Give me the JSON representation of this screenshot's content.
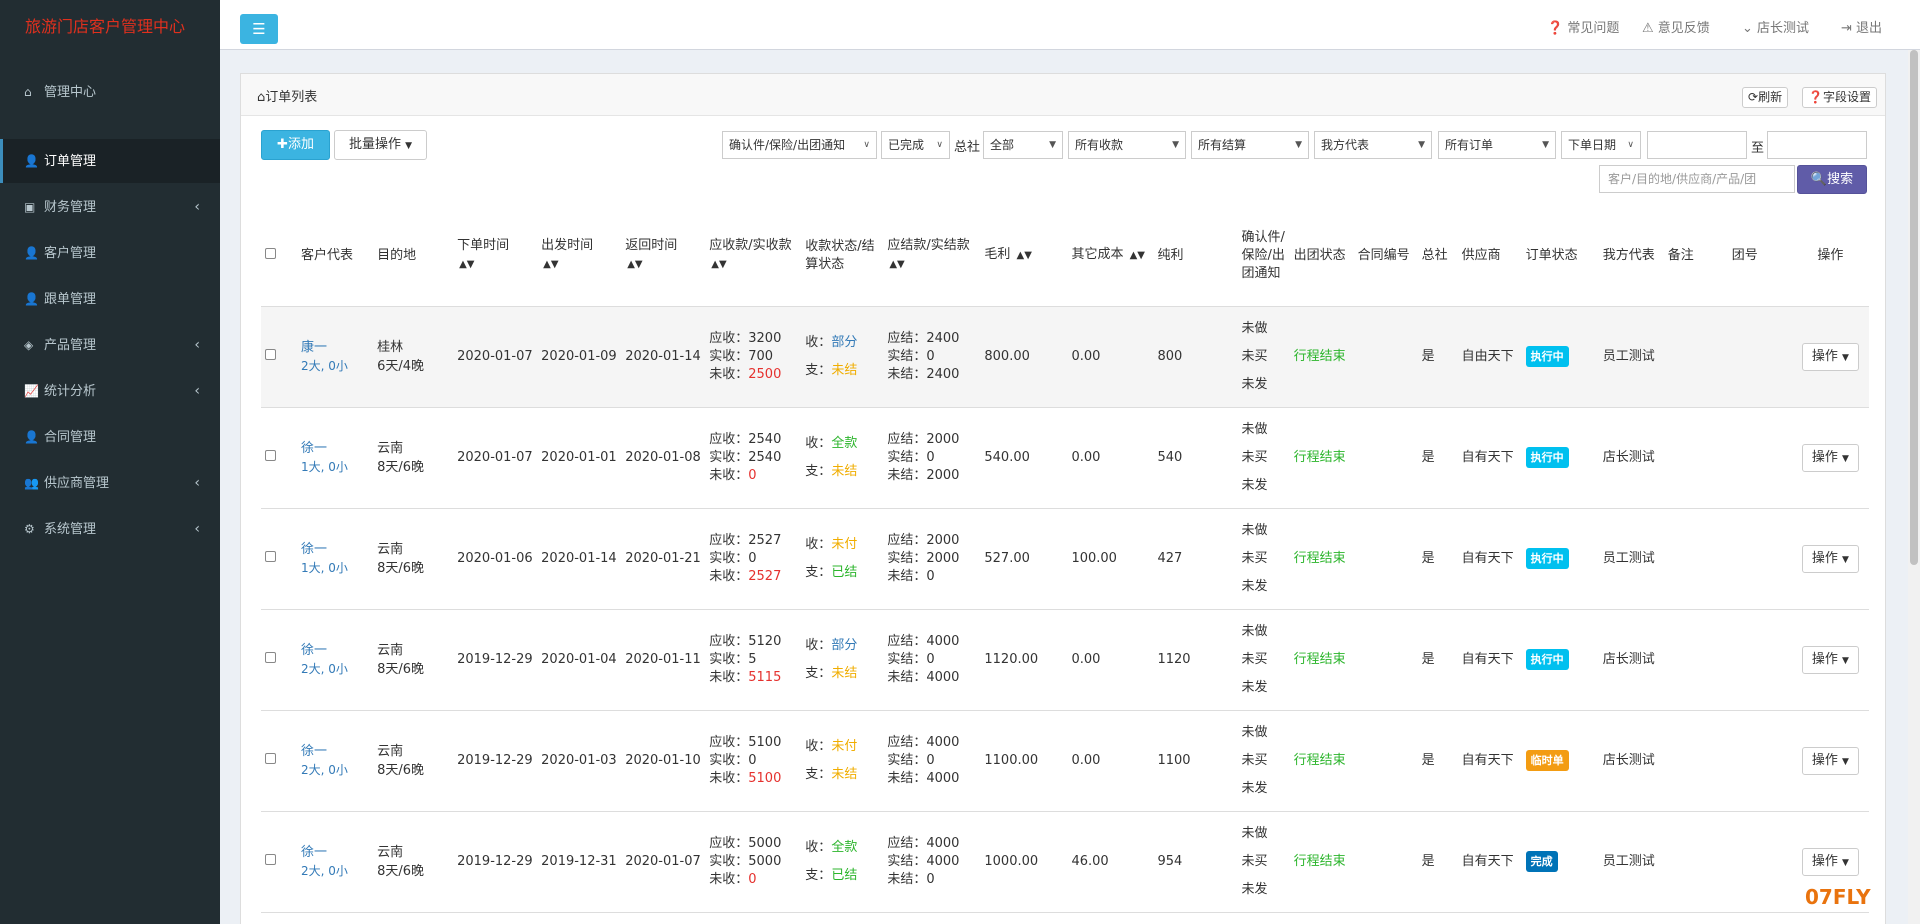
{
  "brand": "旅游门店客户管理中心",
  "nav": [
    {
      "label": "管理中心",
      "icon": "home-icon",
      "active": false,
      "arrow": false
    },
    {
      "label": "订单管理",
      "icon": "user-icon",
      "active": true,
      "arrow": false
    },
    {
      "label": "财务管理",
      "icon": "money-icon",
      "active": false,
      "arrow": true
    },
    {
      "label": "客户管理",
      "icon": "user-icon",
      "active": false,
      "arrow": false
    },
    {
      "label": "跟单管理",
      "icon": "user-icon",
      "active": false,
      "arrow": false
    },
    {
      "label": "产品管理",
      "icon": "cube-icon",
      "active": false,
      "arrow": true
    },
    {
      "label": "统计分析",
      "icon": "chart-icon",
      "active": false,
      "arrow": true
    },
    {
      "label": "合同管理",
      "icon": "user-icon",
      "active": false,
      "arrow": false
    },
    {
      "label": "供应商管理",
      "icon": "users-icon",
      "active": false,
      "arrow": true
    },
    {
      "label": "系统管理",
      "icon": "cogs-icon",
      "active": false,
      "arrow": true
    }
  ],
  "header": {
    "faq": "常见问题",
    "feedback": "意见反馈",
    "user": "店长测试",
    "logout": "退出"
  },
  "panel": {
    "title": "订单列表",
    "refresh": "刷新",
    "field_settings": "字段设置"
  },
  "toolbar": {
    "add": "添加",
    "batch": "批量操作",
    "notify_filter": "确认件/保险/出团通知",
    "status_filter": "已完成",
    "hq_label": "总社",
    "hq_select": "全部",
    "receipt_select": "所有收款",
    "settle_select": "所有结算",
    "rep_select": "我方代表",
    "order_select": "所有订单",
    "date_type": "下单日期",
    "to_label": "至",
    "search_placeholder": "客户/目的地/供应商/产品/团",
    "search_btn": "搜索"
  },
  "columns": {
    "customer": "客户代表",
    "dest": "目的地",
    "order_time": "下单时间",
    "depart_time": "出发时间",
    "return_time": "返回时间",
    "receivable": "应收款/实收款",
    "pay_status": "收款状态/结算状态",
    "payable": "应结款/实结款",
    "gross": "毛利",
    "other_cost": "其它成本",
    "net": "纯利",
    "confirm": "确认件/保险/出团通知",
    "tour_status": "出团状态",
    "contract_no": "合同编号",
    "hq": "总社",
    "supplier": "供应商",
    "order_status": "订单状态",
    "rep": "我方代表",
    "remark": "备注",
    "group_no": "团号",
    "action": "操作"
  },
  "rows": [
    {
      "name": "康一",
      "people": "2大, 0小",
      "dest": "桂林",
      "days": "6天/4晚",
      "order": "2020-01-07",
      "depart": "2020-01-09",
      "ret": "2020-01-14",
      "rcv": "应收：3200",
      "got": "实收：700",
      "unrcv_label": "未收：",
      "unrcv": "2500",
      "in_label": "收：",
      "in_status": "部分",
      "out_label": "支：",
      "out_status": "未结",
      "pay": "应结：2400",
      "paid": "实结：0",
      "unpaid": "未结：2400",
      "gross": "800.00",
      "cost": "0.00",
      "net": "800",
      "c1": "未做",
      "c2": "未买",
      "c3": "未发",
      "tour": "行程结束",
      "hq": "是",
      "supplier": "自由天下",
      "status": "执行中",
      "status_color": "#00c0ef",
      "rep": "员工测试",
      "op": "操作"
    },
    {
      "name": "徐一",
      "people": "1大, 0小",
      "dest": "云南",
      "days": "8天/6晚",
      "order": "2020-01-07",
      "depart": "2020-01-01",
      "ret": "2020-01-08",
      "rcv": "应收：2540",
      "got": "实收：2540",
      "unrcv_label": "未收：",
      "unrcv": "0",
      "in_label": "收：",
      "in_status": "全款",
      "out_label": "支：",
      "out_status": "未结",
      "pay": "应结：2000",
      "paid": "实结：0",
      "unpaid": "未结：2000",
      "gross": "540.00",
      "cost": "0.00",
      "net": "540",
      "c1": "未做",
      "c2": "未买",
      "c3": "未发",
      "tour": "行程结束",
      "hq": "是",
      "supplier": "自有天下",
      "status": "执行中",
      "status_color": "#00c0ef",
      "rep": "店长测试",
      "op": "操作"
    },
    {
      "name": "徐一",
      "people": "1大, 0小",
      "dest": "云南",
      "days": "8天/6晚",
      "order": "2020-01-06",
      "depart": "2020-01-14",
      "ret": "2020-01-21",
      "rcv": "应收：2527",
      "got": "实收：0",
      "unrcv_label": "未收：",
      "unrcv": "2527",
      "in_label": "收：",
      "in_status": "未付",
      "out_label": "支：",
      "out_status": "已结",
      "pay": "应结：2000",
      "paid": "实结：2000",
      "unpaid": "未结：0",
      "gross": "527.00",
      "cost": "100.00",
      "net": "427",
      "c1": "未做",
      "c2": "未买",
      "c3": "未发",
      "tour": "行程结束",
      "hq": "是",
      "supplier": "自有天下",
      "status": "执行中",
      "status_color": "#00c0ef",
      "rep": "员工测试",
      "op": "操作"
    },
    {
      "name": "徐一",
      "people": "2大, 0小",
      "dest": "云南",
      "days": "8天/6晚",
      "order": "2019-12-29",
      "depart": "2020-01-04",
      "ret": "2020-01-11",
      "rcv": "应收：5120",
      "got": "实收：5",
      "unrcv_label": "未收：",
      "unrcv": "5115",
      "in_label": "收：",
      "in_status": "部分",
      "out_label": "支：",
      "out_status": "未结",
      "pay": "应结：4000",
      "paid": "实结：0",
      "unpaid": "未结：4000",
      "gross": "1120.00",
      "cost": "0.00",
      "net": "1120",
      "c1": "未做",
      "c2": "未买",
      "c3": "未发",
      "tour": "行程结束",
      "hq": "是",
      "supplier": "自有天下",
      "status": "执行中",
      "status_color": "#00c0ef",
      "rep": "店长测试",
      "op": "操作"
    },
    {
      "name": "徐一",
      "people": "2大, 0小",
      "dest": "云南",
      "days": "8天/6晚",
      "order": "2019-12-29",
      "depart": "2020-01-03",
      "ret": "2020-01-10",
      "rcv": "应收：5100",
      "got": "实收：0",
      "unrcv_label": "未收：",
      "unrcv": "5100",
      "in_label": "收：",
      "in_status": "未付",
      "out_label": "支：",
      "out_status": "未结",
      "pay": "应结：4000",
      "paid": "实结：0",
      "unpaid": "未结：4000",
      "gross": "1100.00",
      "cost": "0.00",
      "net": "1100",
      "c1": "未做",
      "c2": "未买",
      "c3": "未发",
      "tour": "行程结束",
      "hq": "是",
      "supplier": "自有天下",
      "status": "临时单",
      "status_color": "#f39c12",
      "rep": "店长测试",
      "op": "操作"
    },
    {
      "name": "徐一",
      "people": "2大, 0小",
      "dest": "云南",
      "days": "8天/6晚",
      "order": "2019-12-29",
      "depart": "2019-12-31",
      "ret": "2020-01-07",
      "rcv": "应收：5000",
      "got": "实收：5000",
      "unrcv_label": "未收：",
      "unrcv": "0",
      "in_label": "收：",
      "in_status": "全款",
      "out_label": "支：",
      "out_status": "已结",
      "pay": "应结：4000",
      "paid": "实结：4000",
      "unpaid": "未结：0",
      "gross": "1000.00",
      "cost": "46.00",
      "net": "954",
      "c1": "未做",
      "c2": "未买",
      "c3": "未发",
      "tour": "行程结束",
      "hq": "是",
      "supplier": "自有天下",
      "status": "完成",
      "status_color": "#0073b7",
      "rep": "员工测试",
      "op": "操作"
    }
  ],
  "watermark": "07FLY"
}
